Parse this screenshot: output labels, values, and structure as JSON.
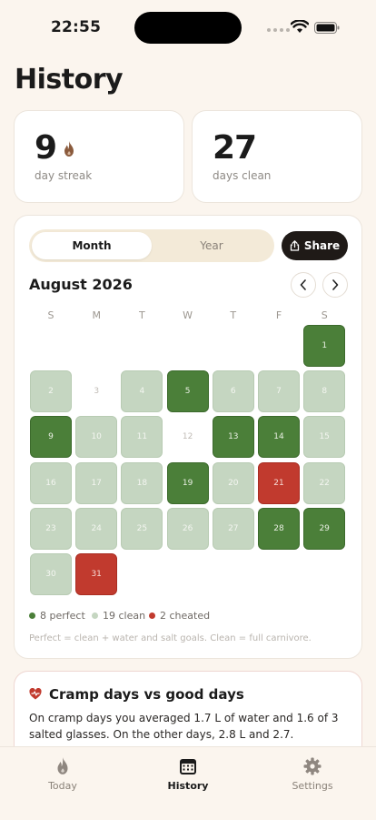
{
  "status": {
    "time": "22:55"
  },
  "page_title": "History",
  "stats": [
    {
      "value": "9",
      "label": "day streak",
      "icon": "flame-icon"
    },
    {
      "value": "27",
      "label": "days clean"
    }
  ],
  "calendar": {
    "tabs": [
      "Month",
      "Year"
    ],
    "active_tab": "Month",
    "share_label": "Share",
    "month_label": "August 2026",
    "weekdays": [
      "S",
      "M",
      "T",
      "W",
      "T",
      "F",
      "S"
    ],
    "first_weekday_index": 6,
    "days": [
      {
        "d": "1",
        "s": "perfect"
      },
      {
        "d": "2",
        "s": "clean"
      },
      {
        "d": "3",
        "s": "none"
      },
      {
        "d": "4",
        "s": "clean"
      },
      {
        "d": "5",
        "s": "perfect"
      },
      {
        "d": "6",
        "s": "clean"
      },
      {
        "d": "7",
        "s": "clean"
      },
      {
        "d": "8",
        "s": "clean"
      },
      {
        "d": "9",
        "s": "perfect"
      },
      {
        "d": "10",
        "s": "clean"
      },
      {
        "d": "11",
        "s": "clean"
      },
      {
        "d": "12",
        "s": "none"
      },
      {
        "d": "13",
        "s": "perfect"
      },
      {
        "d": "14",
        "s": "perfect"
      },
      {
        "d": "15",
        "s": "clean"
      },
      {
        "d": "16",
        "s": "clean"
      },
      {
        "d": "17",
        "s": "clean"
      },
      {
        "d": "18",
        "s": "clean"
      },
      {
        "d": "19",
        "s": "perfect"
      },
      {
        "d": "20",
        "s": "clean"
      },
      {
        "d": "21",
        "s": "cheated"
      },
      {
        "d": "22",
        "s": "clean"
      },
      {
        "d": "23",
        "s": "clean"
      },
      {
        "d": "24",
        "s": "clean"
      },
      {
        "d": "25",
        "s": "clean"
      },
      {
        "d": "26",
        "s": "clean"
      },
      {
        "d": "27",
        "s": "clean"
      },
      {
        "d": "28",
        "s": "perfect"
      },
      {
        "d": "29",
        "s": "perfect"
      },
      {
        "d": "30",
        "s": "clean"
      },
      {
        "d": "31",
        "s": "cheated"
      }
    ],
    "legend": [
      {
        "label": "8 perfect",
        "color": "#4b7f39"
      },
      {
        "label": "19 clean",
        "color": "#c5d6c1"
      },
      {
        "label": "2 cheated",
        "color": "#c13a2e"
      }
    ],
    "footnote": "Perfect = clean + water and salt goals. Clean = full carnivore."
  },
  "cramp": {
    "icon": "heart-pulse-icon",
    "title": "Cramp days vs good days",
    "body": "On cramp days you averaged 1.7 L of water and 1.6 of 3 salted glasses. On the other days, 2.8 L and 2.7."
  },
  "tabbar": {
    "items": [
      {
        "label": "Today",
        "icon": "flame-icon"
      },
      {
        "label": "History",
        "icon": "calendar-icon",
        "active": true
      },
      {
        "label": "Settings",
        "icon": "gear-icon"
      }
    ]
  }
}
